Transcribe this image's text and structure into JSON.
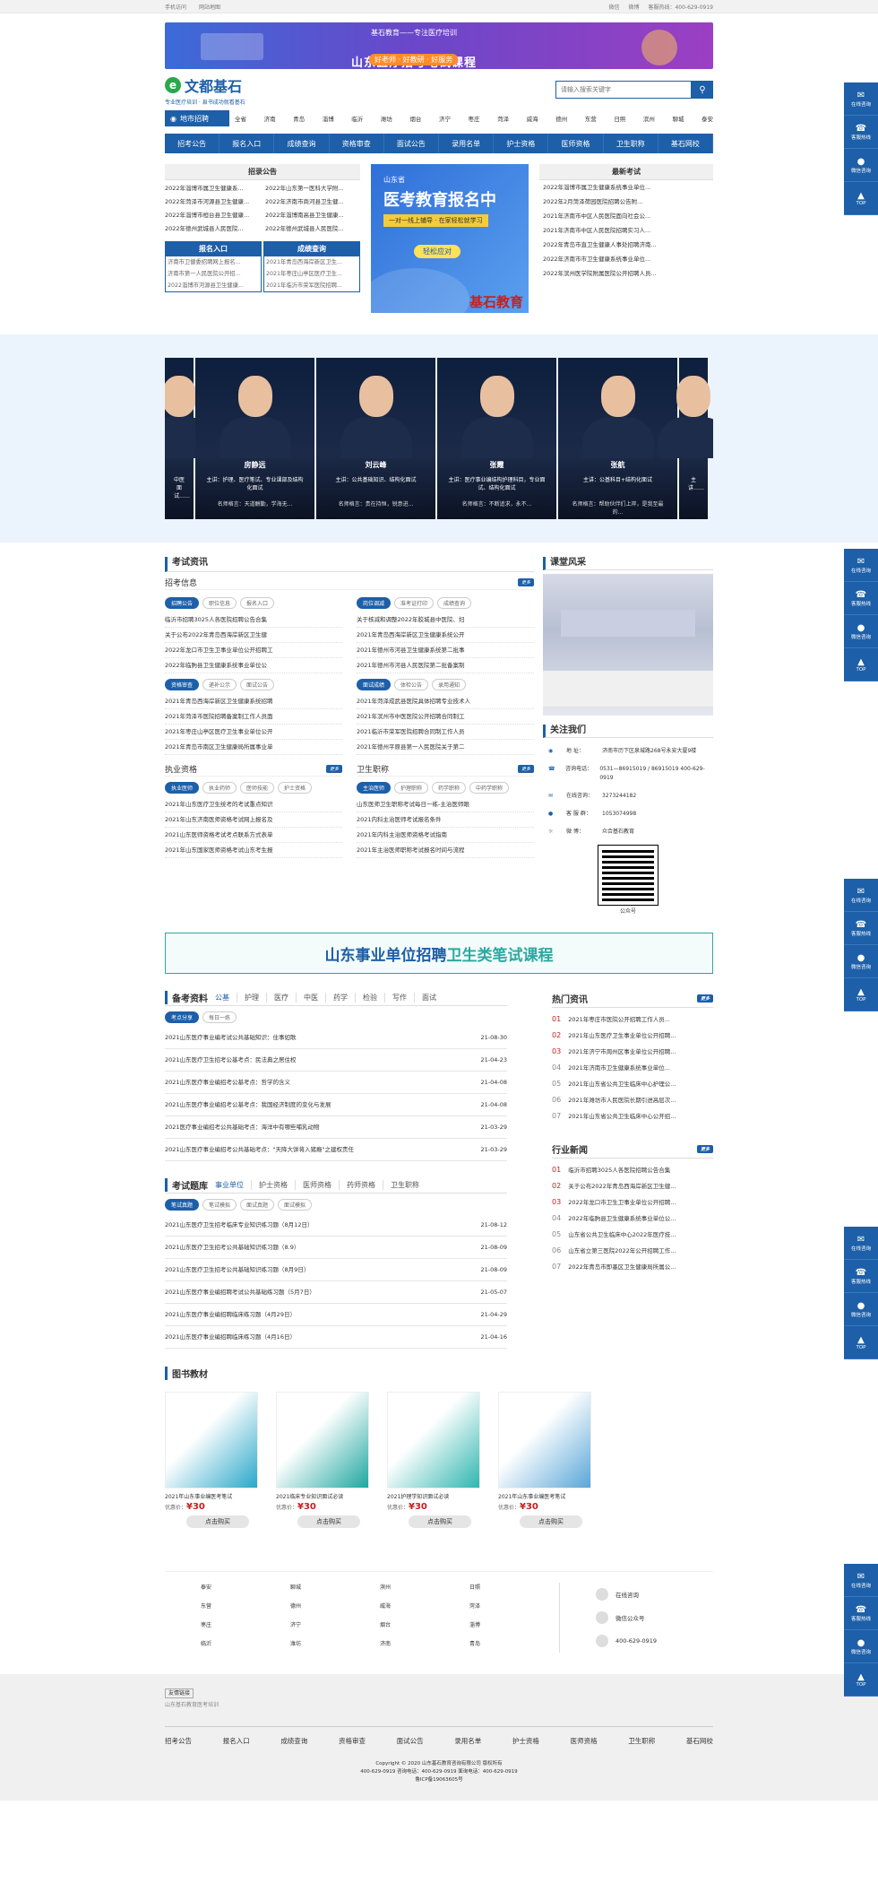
{
  "topbar": {
    "left": [
      "手机访问",
      "网站地图"
    ],
    "right": [
      "微信",
      "微博",
      "客服热线：400-629-0919"
    ]
  },
  "banner": {
    "line1": "基石教育——专注医疗培训",
    "line2": "山东医疗招考笔试课程",
    "line3": "好老师 · 好教研 · 好服务"
  },
  "logo": {
    "name": "文都基石",
    "slogan": "专业医疗培训 · 县书成功就看基石",
    "mark": "e"
  },
  "search": {
    "placeholder": "请输入搜索关键字",
    "icon": "search-icon"
  },
  "cities": {
    "label": "地市招聘",
    "items": [
      "全省",
      "济南",
      "青岛",
      "淄博",
      "临沂",
      "潍坊",
      "烟台",
      "济宁",
      "枣庄",
      "菏泽",
      "威海",
      "德州",
      "东营",
      "日照",
      "滨州",
      "聊城",
      "泰安"
    ]
  },
  "nav": [
    "招考公告",
    "报名入口",
    "成绩查询",
    "资格审查",
    "面试公告",
    "录用名单",
    "护士资格",
    "医师资格",
    "卫生职称",
    "基石网校"
  ],
  "recruit": {
    "title": "招录公告",
    "items": [
      "2022年淄博市属卫生健康系...",
      "2022年山东第一医科大学附...",
      "2022年菏泽市河源县卫生健康...",
      "2022年济南市商河县卫生健...",
      "2022年淄博市桓台县卫生健康...",
      "2022年淄博南高县卫生健康...",
      "2022年德州武城县人民医院...",
      "2022年德州武城县人民医院..."
    ]
  },
  "signup": {
    "title": "报名入口",
    "items": [
      "济南市卫健委招聘网上报名...",
      "济南市第一人民医院公开招...",
      "2022淄博市河源县卫生健康..."
    ]
  },
  "score": {
    "title": "成绩查询",
    "items": [
      "2021年青岛西海岸新区卫生...",
      "2021年枣庄山亭区医疗卫生...",
      "2021年临沂市荣军医院招聘..."
    ]
  },
  "promo": {
    "line1": "山东省",
    "line2": "医考教育报名中",
    "line3": "一对一线上辅导 · 在家轻松就学习",
    "button": "轻松应对",
    "brand": "基石教育"
  },
  "latest": {
    "title": "最新考试",
    "items": [
      "2022年淄博市属卫生健康系统事业单位...",
      "2022年2月菏泽荷园医院招聘公告附...",
      "2021年济南市中区人民医院面向社会公...",
      "2021年济南市中区人民医院招聘实习人...",
      "2022年青岛市直卫生健康人事处招聘济南...",
      "2022年济南市市卫生健康系统事业单位...",
      "2022年滨州医学院附属医院公开招聘人员..."
    ]
  },
  "teachers": [
    {
      "name": "",
      "desc": "中医面试……",
      "motto": ""
    },
    {
      "name": "房静远",
      "desc": "主讲：护理、医疗笔试、专业课部及结构化面试",
      "motto": "名师格言：天道酬勤，学海无..."
    },
    {
      "name": "刘云峰",
      "desc": "主讲：公共基础知识、结构化面试",
      "motto": "名师格言：贵在持恒，锐意进..."
    },
    {
      "name": "张霞",
      "desc": "主讲：医疗事业编结构护理科目，专业面试、结构化面试",
      "motto": "名师格言：不断追求，永不..."
    },
    {
      "name": "张航",
      "desc": "主讲：公基科目+结构化面试",
      "motto": "名师格言：帮助伙伴们上岸，是我至最的..."
    },
    {
      "name": "",
      "desc": "主讲……",
      "motto": ""
    }
  ],
  "exam_news": {
    "title": "考试资讯",
    "sub": "招考信息",
    "more": "更多",
    "block1": {
      "tabs": [
        "招聘公告",
        "职位信息",
        "报名入口"
      ],
      "items": [
        "临沂市招聘3025人各医院招聘公告合集",
        "关于公布2022年青岛西海岸新区卫生健",
        "2022年龙口市卫生卫事业单位公开招聘工",
        "2022年临朐县卫生健康系统事业单位公"
      ]
    },
    "block2": {
      "tabs": [
        "岗位调减",
        "准考证打印",
        "成绩查询"
      ],
      "items": [
        "关于核减和调整2022年胶城县中医院、妇",
        "2021年青岛西海岸新区卫生健康系统公开",
        "2021年德州市河县卫生健康系统第二批事",
        "2021年德州市河县人民医院第二批备案制"
      ]
    },
    "block3": {
      "tabs": [
        "资格审查",
        "递补公示",
        "面试公告"
      ],
      "items": [
        "2021年青岛西海岸新区卫生健康系统招聘",
        "2021年菏泽市医院招聘备案制工作人员面",
        "2021年枣庄山亭区医疗卫生事业单位公开",
        "2021年青岛市南区卫生健康局所属事业单"
      ]
    },
    "block4": {
      "tabs": [
        "面试成绩",
        "体检公告",
        "录用通知"
      ],
      "items": [
        "2021年菏泽成武县医院具体招聘专业技术人",
        "2021年滨州市中医医院公开招聘合同制工",
        "2021临沂市荣军医院招聘合同制工作人员",
        "2021年德州平原县第一人民医院关于第二"
      ]
    }
  },
  "practice": {
    "title": "执业资格",
    "more": "更多",
    "tabs": [
      "执业医师",
      "执业药师",
      "医师技能",
      "护士资格"
    ],
    "items": [
      "2021年山东医疗卫生统考的考试重点知识",
      "2021年山东济南医师资格考试网上报名及",
      "2021山东医师资格考试考点联系方式表单",
      "2021年山东国家医师资格考试山东考生报"
    ]
  },
  "title_job": {
    "title": "卫生职称",
    "more": "更多",
    "tabs": [
      "主治医师",
      "护理职称",
      "药学职称",
      "中药学职称"
    ],
    "items": [
      "山东医师卫生职称考试每日一练-主治医师眼",
      "2021内科主治医师考试报名条件",
      "2021年内科主治医师资格考试指南",
      "2021年主治医师职称考试报名时间与流程"
    ]
  },
  "classroom": {
    "title": "课堂风采"
  },
  "follow": {
    "title": "关注我们",
    "rows": [
      {
        "icon": "location-icon",
        "label": "地    址：",
        "value": "济南市历下区泉城路268号永安大厦9楼"
      },
      {
        "icon": "phone-icon",
        "label": "咨询电话：",
        "value": "0531—86915019 / 86915019  400-629-0919"
      },
      {
        "icon": "chat-icon",
        "label": "在线咨询：",
        "value": "3273244182"
      },
      {
        "icon": "qq-icon",
        "label": "客 服 群：",
        "value": "1053074998"
      },
      {
        "icon": "weibo-icon",
        "label": "微    博：",
        "value": "众合基石教育"
      }
    ],
    "qr_label": "公众号"
  },
  "ad2": {
    "text1": "山东事业单位招聘",
    "text2": "卫生类笔试课程"
  },
  "prep": {
    "title": "备考资料",
    "tabs": [
      "公基",
      "护理",
      "医疗",
      "中医",
      "药学",
      "检验",
      "写作",
      "面试"
    ],
    "subtabs": [
      "考点分享",
      "每日一练"
    ],
    "items": [
      [
        "2021山东医疗事业编考试公共基础知识：住事如歌",
        "21-08-30"
      ],
      [
        "2021山东医疗卫生招考公基考点：民法典之居住权",
        "21-04-23"
      ],
      [
        "2021山东医疗事业编招考公基考点：哲学的含义",
        "21-04-08"
      ],
      [
        "2021山东医疗事业编招考公基考点：我国经济制度的变化与发展",
        "21-04-08"
      ],
      [
        "2021医疗事业编招考公共基础考点：海洋中有哪些哺乳动物",
        "21-03-29"
      ],
      [
        "2021山东医疗事业编招考公共基础考点：\"天降大饼将入猪瘾\"之建权责任",
        "21-03-29"
      ]
    ]
  },
  "bank": {
    "title": "考试题库",
    "tabs": [
      "事业单位",
      "护士资格",
      "医师资格",
      "药师资格",
      "卫生职称"
    ],
    "subtabs": [
      "笔试真题",
      "笔试模拟",
      "面试真题",
      "面试模拟"
    ],
    "items": [
      [
        "2021山东医疗卫生招考临床专业知识练习题（8月12日）",
        "21-08-12"
      ],
      [
        "2021山东医疗卫生招考公共基础知识练习题（8.9）",
        "21-08-09"
      ],
      [
        "2021山东医疗卫生招考公共基础知识练习题（8月9日）",
        "21-08-09"
      ],
      [
        "2021山东医疗事业编招聘考试公共基础练习题（5月7日）",
        "21-05-07"
      ],
      [
        "2021山东医疗事业编招聘临床练习题（4月29日）",
        "21-04-29"
      ],
      [
        "2021山东医疗事业编招聘临床练习题（4月16日）",
        "21-04-16"
      ]
    ]
  },
  "hot": {
    "title": "热门资讯",
    "more": "更多",
    "items": [
      "2021年枣庄市医院公开招聘工作人员...",
      "2021年山东医疗卫生事业单位公开招聘...",
      "2021年济宁市周州区事业单位公开招聘...",
      "2021年济南市卫生健康系统事业单位...",
      "2021年山东省公共卫生临床中心护理公...",
      "2021年潍坊市人民医院长期引进高层次...",
      "2021年山东省公共卫生临床中心公开招..."
    ]
  },
  "industry": {
    "title": "行业新闻",
    "more": "更多",
    "items": [
      "临沂市招聘3025人各医院招聘公告合集",
      "关于公布2022年青岛西海岸新区卫生健...",
      "2022年龙口市卫生卫事业单位公开招聘...",
      "2022年临朐县卫生健康系统事业单位公...",
      "山东省公共卫生临床中心2022年医疗技...",
      "山东省立第三医院2022年公开招聘工作...",
      "2022年青岛市即墨区卫生健康局所属公..."
    ]
  },
  "books": {
    "title": "图书教材",
    "price_label": "优惠价：",
    "buy": "点击购买",
    "items": [
      {
        "title": "2021年山东事业编医考笔试",
        "price": "¥30"
      },
      {
        "title": "2021临床专业知识面试必读",
        "price": "¥30"
      },
      {
        "title": "2021护理学知识面试必读",
        "price": "¥30"
      },
      {
        "title": "2021年山东事业编医考笔试",
        "price": "¥30"
      }
    ]
  },
  "footer_cities": [
    "泰安",
    "聊城",
    "滨州",
    "日照",
    "东营",
    "德州",
    "威海",
    "菏泽",
    "枣庄",
    "济宁",
    "烟台",
    "淄博",
    "临沂",
    "潍坊",
    "济南",
    "青岛"
  ],
  "footer_contact": [
    "在线咨询",
    "微信公众号",
    "400-629-0919"
  ],
  "friend": {
    "label": "友情链接",
    "item": "山东基石教育医考培训"
  },
  "copyright": [
    "Copyright © 2020 山东基石教育咨询有限公司 版权所有",
    "400-629-0919 咨询电话：400-629-0919 面询电话：400-629-0919",
    "鲁ICP备19063605号"
  ],
  "float_buttons": [
    {
      "label": "在线咨询",
      "icon": "chat-icon"
    },
    {
      "label": "客服热线",
      "icon": "phone-icon"
    },
    {
      "label": "微信咨询",
      "icon": "wechat-icon"
    },
    {
      "label": "TOP",
      "icon": "arrow-up-icon"
    }
  ]
}
